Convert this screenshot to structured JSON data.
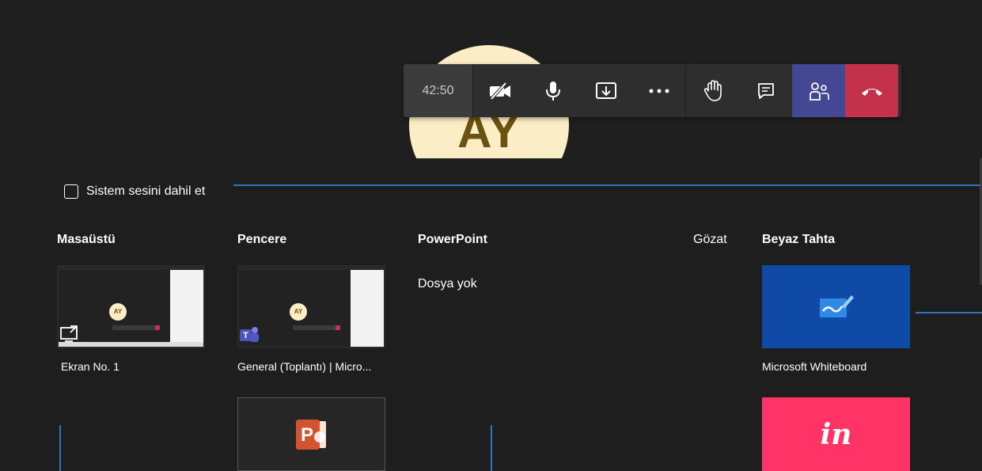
{
  "meeting": {
    "avatar_initials": "AY",
    "timer": "42:50",
    "toolbar": {
      "camera": "camera-off-icon",
      "mic": "microphone-icon",
      "share": "share-tray-icon",
      "more": "more-icon",
      "raise_hand": "raise-hand-icon",
      "chat": "chat-icon",
      "participants": "participants-icon",
      "hangup": "hangup-icon"
    },
    "colors": {
      "participants_bg": "#444791",
      "hangup_bg": "#c4314b"
    }
  },
  "share_tray": {
    "system_audio_label": "Sistem sesini dahil et",
    "columns": {
      "desktop": {
        "title": "Masaüstü",
        "items": [
          {
            "label": "Ekran No. 1"
          }
        ]
      },
      "window": {
        "title": "Pencere",
        "items": [
          {
            "label": "General (Toplantı) | Micro..."
          }
        ]
      },
      "powerpoint": {
        "title": "PowerPoint",
        "empty_text": "Dosya yok",
        "browse_label": "Gözat"
      },
      "whiteboard": {
        "title": "Beyaz Tahta",
        "items": [
          {
            "label": "Microsoft Whiteboard"
          },
          {
            "label": "in"
          }
        ]
      }
    }
  }
}
